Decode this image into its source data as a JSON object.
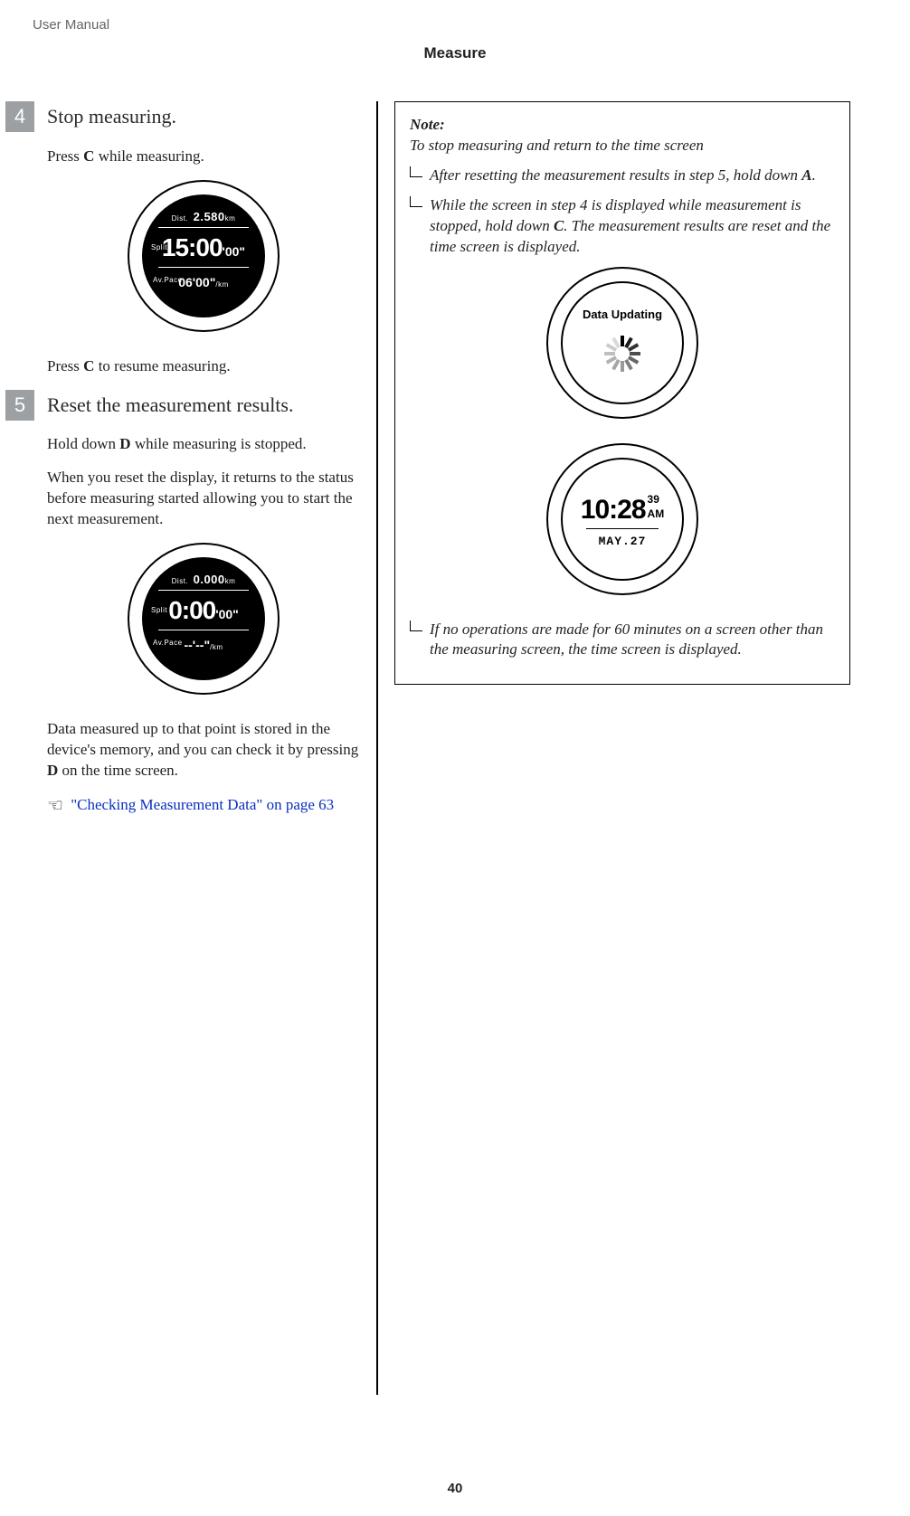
{
  "header": "User Manual",
  "section": "Measure",
  "page_number": "40",
  "left": {
    "step4": {
      "num": "4",
      "heading": "Stop measuring.",
      "p1_before": "Press ",
      "p1_bold": "C",
      "p1_after": " while measuring.",
      "watch": {
        "dist_label": "Dist.",
        "dist_val": "2.580",
        "dist_unit": "km",
        "split_label": "Split",
        "split_val": "15:00",
        "split_sec": "'00\"",
        "pace_label": "Av.Pace",
        "pace_val": "06'00\"",
        "pace_unit": "/km"
      },
      "p2_before": "Press ",
      "p2_bold": "C",
      "p2_after": " to resume measuring."
    },
    "step5": {
      "num": "5",
      "heading": "Reset the measurement results.",
      "p1_before": "Hold down ",
      "p1_bold": "D",
      "p1_after": " while measuring is stopped.",
      "p2": "When you reset the display, it returns to the status before measuring started allowing you to start the next measurement.",
      "watch": {
        "dist_label": "Dist.",
        "dist_val": "0.000",
        "dist_unit": "km",
        "split_label": "Split",
        "split_val": "0:00",
        "split_sec": "'00\"",
        "pace_label": "Av.Pace",
        "pace_val": "--'--\"",
        "pace_unit": "/km"
      },
      "p3_before": "Data measured up to that point is stored in the device's memory, and you can check it by pressing ",
      "p3_bold": "D",
      "p3_after": " on the time screen.",
      "link": "\"Checking Measurement Data\" on page 63"
    }
  },
  "right": {
    "note_label": "Note:",
    "note_intro": "To stop measuring and return to the time screen",
    "items": {
      "i1_before": "After resetting the measurement results in step 5, hold down ",
      "i1_bold": "A",
      "i1_after": ".",
      "i2_a": "While the screen in step 4 is displayed while measurement is stopped, hold down ",
      "i2_bold": "C",
      "i2_b": ". The measurement results are reset and the time screen is displayed.",
      "i3": "If no operations are made for 60 minutes on a screen other than the measuring screen, the time screen is displayed."
    },
    "watch_updating": {
      "text": "Data Updating"
    },
    "watch_time": {
      "time": "10:28",
      "sec": "39",
      "ampm": "AM",
      "date": "MAY.27"
    }
  }
}
